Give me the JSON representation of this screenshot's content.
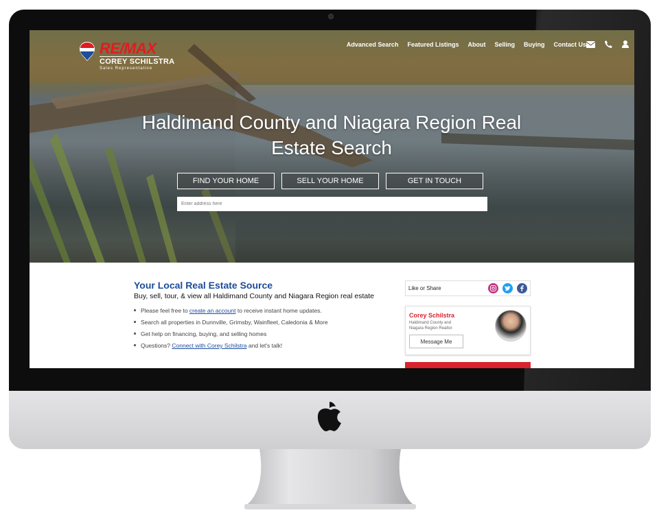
{
  "brand": {
    "logo_text": "RE/MAX",
    "agent_name": "COREY SCHILSTRA",
    "agent_title": "Sales Representative"
  },
  "nav": {
    "items": [
      "Advanced Search",
      "Featured Listings",
      "About",
      "Selling",
      "Buying",
      "Contact Us"
    ],
    "icons": [
      "envelope-icon",
      "phone-icon",
      "user-icon"
    ]
  },
  "hero": {
    "title": "Haldimand County and Niagara Region Real Estate Search",
    "buttons": [
      "FIND YOUR HOME",
      "SELL YOUR HOME",
      "GET IN TOUCH"
    ],
    "search_placeholder": "Enter address here"
  },
  "main": {
    "title": "Your Local Real Estate Source",
    "subtitle": "Buy, sell, tour, & view all Haldimand County and Niagara Region real estate",
    "bullets": {
      "b1_pre": "Please feel free to",
      "b1_link": "create an account",
      "b1_post": "to receive instant home updates.",
      "b2": "Search all properties in Dunnville, Grimsby, Wainfleet, Caledonia & More",
      "b3": "Get help on financing, buying, and selling homes",
      "b4_pre": "Questions?",
      "b4_link": "Connect with Corey Schilstra",
      "b4_post": "and let's talk!"
    }
  },
  "sidebar": {
    "share_label": "Like or Share",
    "social": [
      "instagram-icon",
      "twitter-icon",
      "facebook-icon"
    ],
    "agent": {
      "name": "Corey Schilstra",
      "description": "Haldimand County and Niagara Region Realtor",
      "button": "Message Me"
    }
  },
  "colors": {
    "accent_blue": "#1b4b9a",
    "brand_red": "#d9232e",
    "instagram": "#c13584",
    "twitter": "#1da1f2",
    "facebook": "#3b5998"
  }
}
